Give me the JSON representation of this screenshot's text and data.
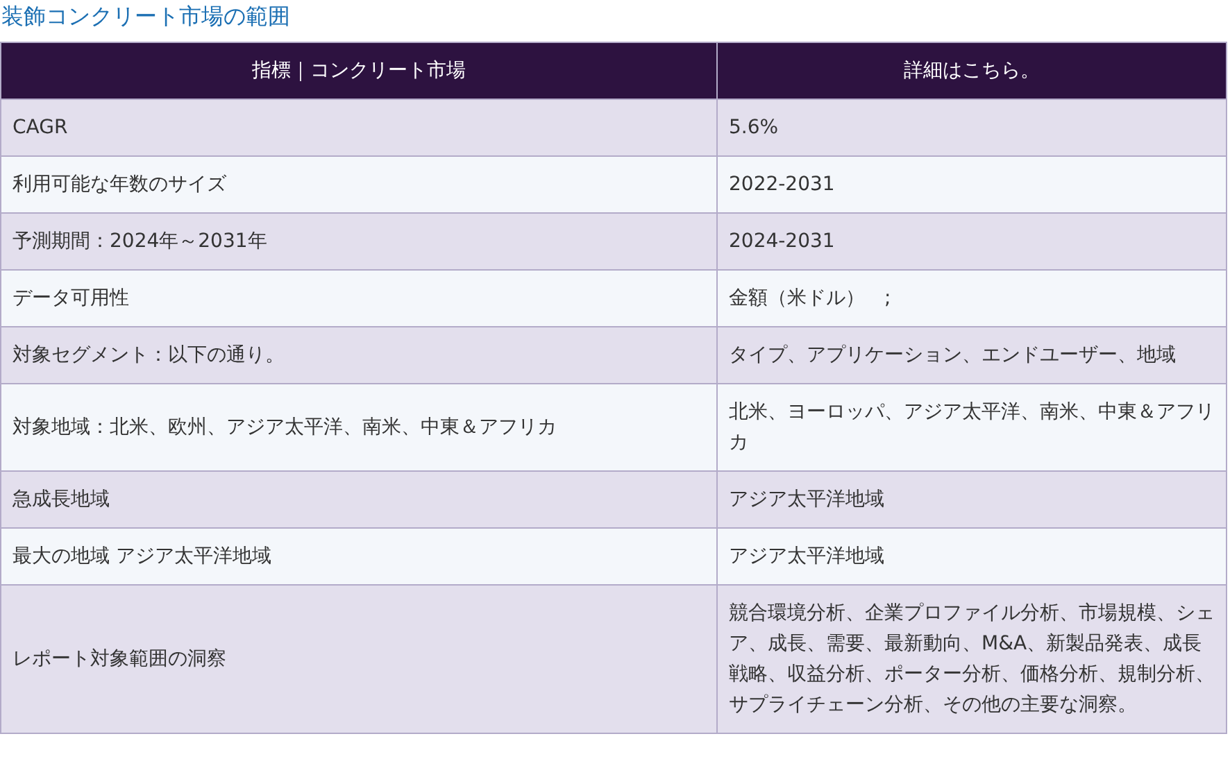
{
  "title": "装飾コンクリート市場の範囲",
  "table": {
    "columns": [
      "指標｜コンクリート市場",
      "詳細はこちら。"
    ],
    "rows": [
      [
        "CAGR",
        "5.6%"
      ],
      [
        "利用可能な年数のサイズ",
        "2022-2031"
      ],
      [
        "予測期間：2024年～2031年",
        "2024-2031"
      ],
      [
        "データ可用性",
        "金額（米ドル）　;"
      ],
      [
        "対象セグメント：以下の通り。",
        "タイプ、アプリケーション、エンドユーザー、地域"
      ],
      [
        "対象地域：北米、欧州、アジア太平洋、南米、中東＆アフリカ",
        "北米、ヨーロッパ、アジア太平洋、南米、中東＆アフリカ"
      ],
      [
        "急成長地域",
        "アジア太平洋地域"
      ],
      [
        "最大の地域 アジア太平洋地域",
        "アジア太平洋地域"
      ],
      [
        "レポート対象範囲の洞察",
        "競合環境分析、企業プロファイル分析、市場規模、シェア、成長、需要、最新動向、M&A、新製品発表、成長戦略、収益分析、ポーター分析、価格分析、規制分析、サプライチェーン分析、その他の主要な洞察。"
      ]
    ]
  }
}
